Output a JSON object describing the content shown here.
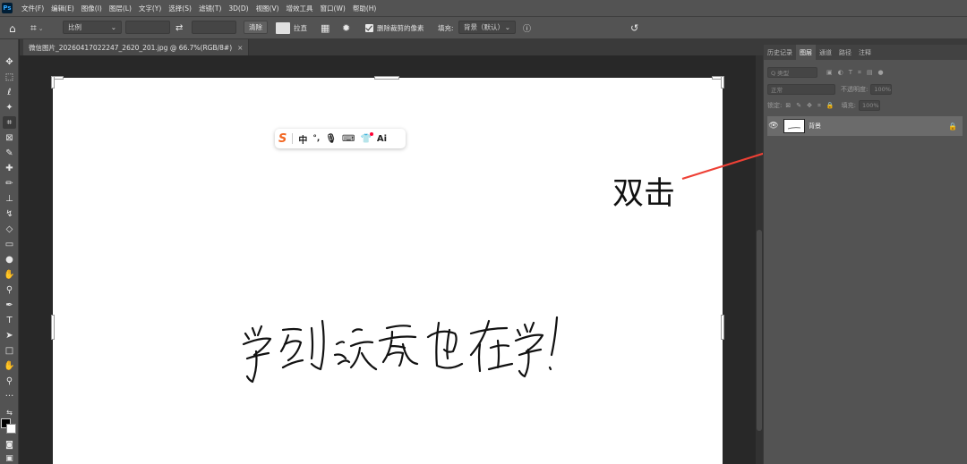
{
  "app": {
    "logo": "Ps"
  },
  "menu": [
    "文件(F)",
    "编辑(E)",
    "图像(I)",
    "图层(L)",
    "文字(Y)",
    "选择(S)",
    "滤镜(T)",
    "3D(D)",
    "视图(V)",
    "增效工具",
    "窗口(W)",
    "帮助(H)"
  ],
  "options": {
    "ratio_select": "比例",
    "clear_button": "清除",
    "straighten_label": "拉直",
    "delete_cropped_label": "删除裁剪的像素",
    "fill_label": "填充:",
    "fill_select": "背景（默认）"
  },
  "document": {
    "tab_title": "微信图片_20260417022247_2620_201.jpg @ 66.7%(RGB/8#)",
    "tab_close": "×",
    "handwriting": "学到就是也在学！"
  },
  "ime_toolbar": {
    "mode": "中",
    "ai": "Ai"
  },
  "annotation": {
    "text": "双击",
    "color": "#ee4035"
  },
  "panel": {
    "tabs": [
      "历史记录",
      "图层",
      "通道",
      "路径",
      "注释"
    ],
    "active_tab": "图层",
    "kind_placeholder": "Q 类型",
    "blend_mode": "正常",
    "opacity_label": "不透明度:",
    "opacity_value": "100%",
    "lock_label": "锁定:",
    "fill_label": "填充:",
    "fill_value": "100%",
    "layers": [
      {
        "name": "背景",
        "visible": true,
        "locked": true
      }
    ]
  }
}
